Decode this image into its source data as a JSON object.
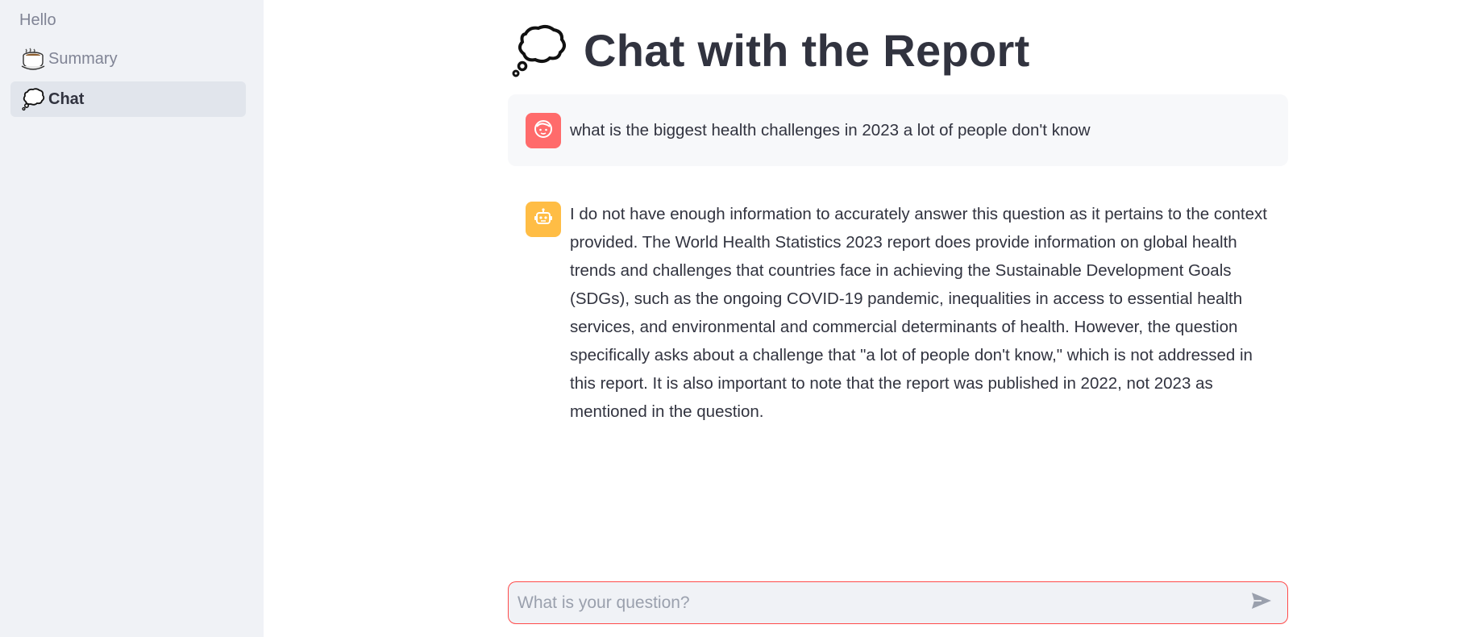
{
  "sidebar": {
    "items": [
      {
        "label": "Hello",
        "icon": "none",
        "active": false
      },
      {
        "label": "Summary",
        "icon": "hot-beverage-icon",
        "active": false
      },
      {
        "label": "Chat",
        "icon": "thought-bubble-icon",
        "active": true
      }
    ]
  },
  "main": {
    "title": "Chat with the Report",
    "title_icon": "thought-bubble-icon",
    "messages": [
      {
        "role": "user",
        "avatar_icon": "user-face-icon",
        "avatar_color": "#ff6b6b",
        "text": "what is the biggest health challenges in 2023 a lot of people don't know"
      },
      {
        "role": "assistant",
        "avatar_icon": "robot-icon",
        "avatar_color": "#ffbd45",
        "text": "I do not have enough information to accurately answer this question as it pertains to the context provided. The World Health Statistics 2023 report does provide information on global health trends and challenges that countries face in achieving the Sustainable Development Goals (SDGs), such as the ongoing COVID-19 pandemic, inequalities in access to essential health services, and environmental and commercial determinants of health. However, the question specifically asks about a challenge that \"a lot of people don't know,\" which is not addressed in this report. It is also important to note that the report was published in 2022, not 2023 as mentioned in the question."
      }
    ],
    "chat_input": {
      "placeholder": "What is your question?",
      "value": "",
      "send_icon": "send-icon"
    }
  },
  "colors": {
    "sidebar_bg": "#f0f2f6",
    "accent": "#ff4b4b",
    "text": "#31333f"
  }
}
